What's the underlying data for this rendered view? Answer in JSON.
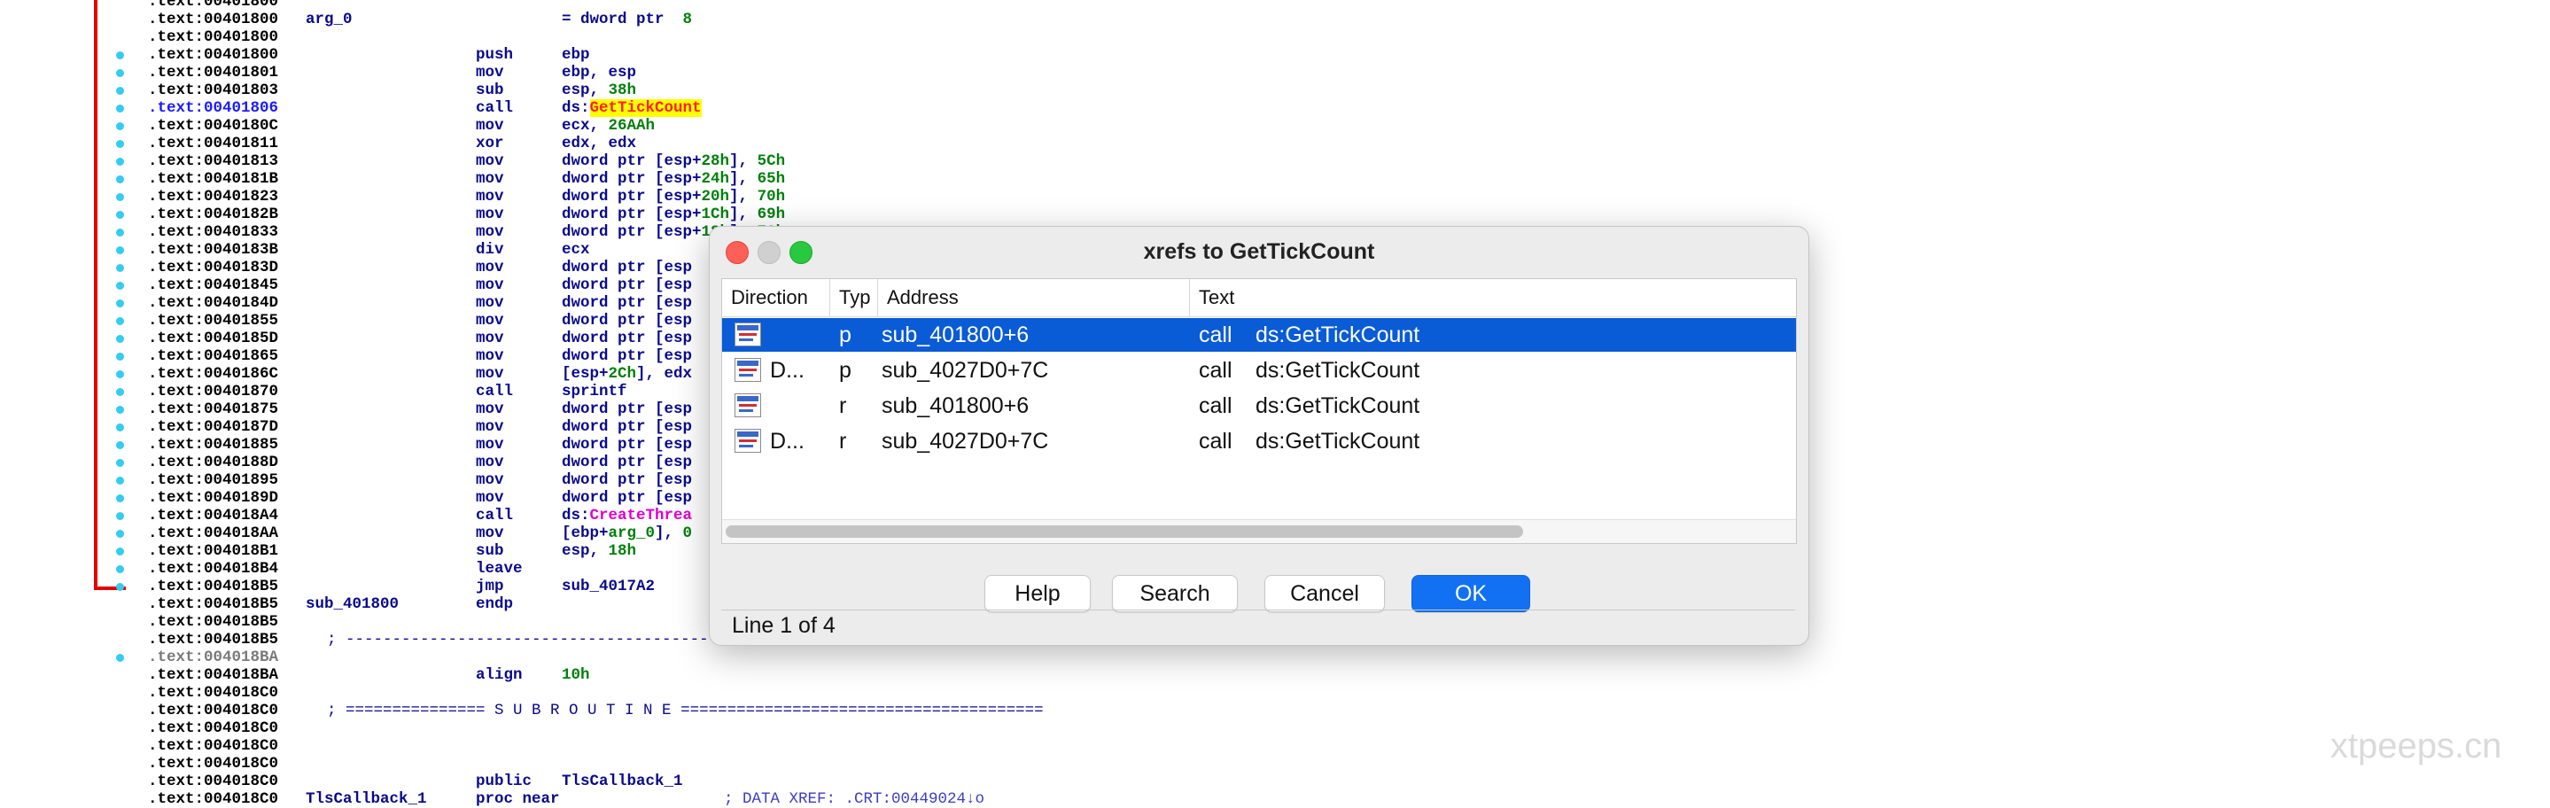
{
  "listing": {
    "lines": [
      {
        "addr": ".text:00401800",
        "label": "",
        "mn": "",
        "ops": []
      },
      {
        "addr": ".text:00401800",
        "label": "arg_0",
        "mn": "",
        "ops": [
          {
            "t": "= dword ptr  "
          },
          {
            "t": "8",
            "c": "num"
          }
        ]
      },
      {
        "addr": ".text:00401800",
        "label": "",
        "mn": "",
        "ops": []
      },
      {
        "addr": ".text:00401800",
        "label": "",
        "mn": "push",
        "ops": [
          {
            "t": "ebp"
          }
        ]
      },
      {
        "addr": ".text:00401801",
        "label": "",
        "mn": "mov",
        "ops": [
          {
            "t": "ebp, esp"
          }
        ]
      },
      {
        "addr": ".text:00401803",
        "label": "",
        "mn": "sub",
        "ops": [
          {
            "t": "esp, "
          },
          {
            "t": "38h",
            "c": "num"
          }
        ]
      },
      {
        "addr": ".text:00401806",
        "label": "",
        "mn": "call",
        "hl": true,
        "ops": [
          {
            "t": "ds:"
          },
          {
            "t": "GetTickCount",
            "c": "yhl"
          }
        ]
      },
      {
        "addr": ".text:0040180C",
        "label": "",
        "mn": "mov",
        "ops": [
          {
            "t": "ecx, "
          },
          {
            "t": "26AAh",
            "c": "num"
          }
        ]
      },
      {
        "addr": ".text:00401811",
        "label": "",
        "mn": "xor",
        "ops": [
          {
            "t": "edx, edx"
          }
        ]
      },
      {
        "addr": ".text:00401813",
        "label": "",
        "mn": "mov",
        "ops": [
          {
            "t": "dword ptr [esp+"
          },
          {
            "t": "28h",
            "c": "num"
          },
          {
            "t": "], "
          },
          {
            "t": "5Ch",
            "c": "num"
          }
        ]
      },
      {
        "addr": ".text:0040181B",
        "label": "",
        "mn": "mov",
        "ops": [
          {
            "t": "dword ptr [esp+"
          },
          {
            "t": "24h",
            "c": "num"
          },
          {
            "t": "], "
          },
          {
            "t": "65h",
            "c": "num"
          }
        ]
      },
      {
        "addr": ".text:00401823",
        "label": "",
        "mn": "mov",
        "ops": [
          {
            "t": "dword ptr [esp+"
          },
          {
            "t": "20h",
            "c": "num"
          },
          {
            "t": "], "
          },
          {
            "t": "70h",
            "c": "num"
          }
        ]
      },
      {
        "addr": ".text:0040182B",
        "label": "",
        "mn": "mov",
        "ops": [
          {
            "t": "dword ptr [esp+"
          },
          {
            "t": "1Ch",
            "c": "num"
          },
          {
            "t": "], "
          },
          {
            "t": "69h",
            "c": "num"
          }
        ]
      },
      {
        "addr": ".text:00401833",
        "label": "",
        "mn": "mov",
        "ops": [
          {
            "t": "dword ptr [esp+"
          },
          {
            "t": "18h",
            "c": "num"
          },
          {
            "t": "], "
          },
          {
            "t": "70h",
            "c": "num"
          }
        ]
      },
      {
        "addr": ".text:0040183B",
        "label": "",
        "mn": "div",
        "ops": [
          {
            "t": "ecx"
          }
        ]
      },
      {
        "addr": ".text:0040183D",
        "label": "",
        "mn": "mov",
        "ops": [
          {
            "t": "dword ptr [esp"
          }
        ]
      },
      {
        "addr": ".text:00401845",
        "label": "",
        "mn": "mov",
        "ops": [
          {
            "t": "dword ptr [esp"
          }
        ]
      },
      {
        "addr": ".text:0040184D",
        "label": "",
        "mn": "mov",
        "ops": [
          {
            "t": "dword ptr [esp"
          }
        ]
      },
      {
        "addr": ".text:00401855",
        "label": "",
        "mn": "mov",
        "ops": [
          {
            "t": "dword ptr [esp"
          }
        ]
      },
      {
        "addr": ".text:0040185D",
        "label": "",
        "mn": "mov",
        "ops": [
          {
            "t": "dword ptr [esp"
          }
        ]
      },
      {
        "addr": ".text:00401865",
        "label": "",
        "mn": "mov",
        "ops": [
          {
            "t": "dword ptr [esp"
          }
        ]
      },
      {
        "addr": ".text:0040186C",
        "label": "",
        "mn": "mov",
        "ops": [
          {
            "t": "[esp+"
          },
          {
            "t": "2Ch",
            "c": "num"
          },
          {
            "t": "], edx"
          }
        ]
      },
      {
        "addr": ".text:00401870",
        "label": "",
        "mn": "call",
        "ops": [
          {
            "t": "sprintf"
          }
        ]
      },
      {
        "addr": ".text:00401875",
        "label": "",
        "mn": "mov",
        "ops": [
          {
            "t": "dword ptr [esp"
          }
        ]
      },
      {
        "addr": ".text:0040187D",
        "label": "",
        "mn": "mov",
        "ops": [
          {
            "t": "dword ptr [esp"
          }
        ]
      },
      {
        "addr": ".text:00401885",
        "label": "",
        "mn": "mov",
        "ops": [
          {
            "t": "dword ptr [esp"
          }
        ]
      },
      {
        "addr": ".text:0040188D",
        "label": "",
        "mn": "mov",
        "ops": [
          {
            "t": "dword ptr [esp"
          }
        ]
      },
      {
        "addr": ".text:00401895",
        "label": "",
        "mn": "mov",
        "ops": [
          {
            "t": "dword ptr [esp"
          }
        ]
      },
      {
        "addr": ".text:0040189D",
        "label": "",
        "mn": "mov",
        "ops": [
          {
            "t": "dword ptr [esp"
          }
        ]
      },
      {
        "addr": ".text:004018A4",
        "label": "",
        "mn": "call",
        "ops": [
          {
            "t": "ds:"
          },
          {
            "t": "CreateThrea",
            "c": "api"
          }
        ]
      },
      {
        "addr": ".text:004018AA",
        "label": "",
        "mn": "mov",
        "ops": [
          {
            "t": "[ebp+"
          },
          {
            "t": "arg_0",
            "c": "num"
          },
          {
            "t": "], "
          },
          {
            "t": "0",
            "c": "num"
          }
        ]
      },
      {
        "addr": ".text:004018B1",
        "label": "",
        "mn": "sub",
        "ops": [
          {
            "t": "esp, "
          },
          {
            "t": "18h",
            "c": "num"
          }
        ]
      },
      {
        "addr": ".text:004018B4",
        "label": "",
        "mn": "leave",
        "ops": []
      },
      {
        "addr": ".text:004018B5",
        "label": "",
        "mn": "jmp",
        "ops": [
          {
            "t": "sub_4017A2"
          }
        ]
      },
      {
        "addr": ".text:004018B5",
        "label": "sub_401800",
        "mn": "endp",
        "ops": []
      },
      {
        "addr": ".text:004018B5",
        "label": "",
        "mn": "",
        "ops": []
      },
      {
        "addr": ".text:004018B5",
        "label": "",
        "mn": "",
        "ops": [],
        "raw": "; ---------------------------------------------"
      },
      {
        "addr": ".text:004018BA",
        "label": "",
        "mn": "",
        "ops": [],
        "gray": true
      },
      {
        "addr": ".text:004018BA",
        "label": "",
        "mn": "align",
        "ops": [
          {
            "t": "10h",
            "c": "num"
          }
        ]
      },
      {
        "addr": ".text:004018C0",
        "label": "",
        "mn": "",
        "ops": []
      },
      {
        "addr": ".text:004018C0",
        "label": "",
        "mn": "",
        "ops": [],
        "raw": "; =============== S U B R O U T I N E ======================================="
      },
      {
        "addr": ".text:004018C0",
        "label": "",
        "mn": "",
        "ops": []
      },
      {
        "addr": ".text:004018C0",
        "label": "",
        "mn": "",
        "ops": []
      },
      {
        "addr": ".text:004018C0",
        "label": "",
        "mn": "",
        "ops": []
      },
      {
        "addr": ".text:004018C0",
        "label": "",
        "mn": "public",
        "ops": [
          {
            "t": "TlsCallback_1"
          }
        ]
      },
      {
        "addr": ".text:004018C0",
        "label": "TlsCallback_1",
        "mn": "proc near",
        "ops": [],
        "comment": "; DATA XREF: .CRT:00449024↓o"
      }
    ]
  },
  "dialog": {
    "title": "xrefs to GetTickCount",
    "columns": [
      "Direction",
      "Typ",
      "Address",
      "Text"
    ],
    "rows": [
      {
        "direction": "",
        "type": "p",
        "address": "sub_401800+6",
        "instr": "call",
        "operand": "ds:GetTickCount",
        "selected": true
      },
      {
        "direction": "D...",
        "type": "p",
        "address": "sub_4027D0+7C",
        "instr": "call",
        "operand": "ds:GetTickCount",
        "selected": false
      },
      {
        "direction": "",
        "type": "r",
        "address": "sub_401800+6",
        "instr": "call",
        "operand": "ds:GetTickCount",
        "selected": false
      },
      {
        "direction": "D...",
        "type": "r",
        "address": "sub_4027D0+7C",
        "instr": "call",
        "operand": "ds:GetTickCount",
        "selected": false
      }
    ],
    "buttons": {
      "help": "Help",
      "search": "Search",
      "cancel": "Cancel",
      "ok": "OK"
    },
    "status": "Line 1 of 4"
  },
  "colors": {
    "accent": "#0a5bd6",
    "ok_button": "#1271f2",
    "breakpoint_bar": "#e40000",
    "trace_dot": "#33ccf2"
  },
  "watermark": "xtpeeps.cn"
}
